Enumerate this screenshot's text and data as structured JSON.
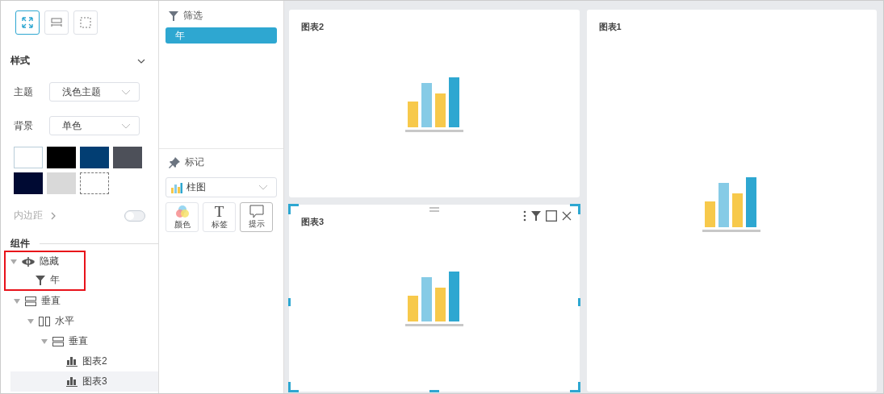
{
  "toolbar": [
    {
      "kind": "fit",
      "selected": true
    },
    {
      "kind": "width",
      "selected": false
    },
    {
      "kind": "free",
      "selected": false
    }
  ],
  "style": {
    "title": "样式",
    "expanded": true,
    "fields": [
      {
        "label": "主题",
        "value": "浅色主题"
      },
      {
        "label": "背景",
        "value": "单色"
      }
    ],
    "swatches": [
      {
        "kind": "color",
        "color": "#ffffff",
        "selected": true
      },
      {
        "kind": "color",
        "color": "#000000",
        "selected": false
      },
      {
        "kind": "color",
        "color": "#023e73",
        "selected": false
      },
      {
        "kind": "color",
        "color": "#4d5059",
        "selected": false
      },
      {
        "kind": "color",
        "color": "#000a33",
        "selected": false
      },
      {
        "kind": "color",
        "color": "#d9d9d9",
        "selected": false
      },
      {
        "kind": "none",
        "selected": false
      }
    ],
    "padding": {
      "label": "内边距",
      "on": false
    }
  },
  "components": {
    "title": "组件",
    "tree": [
      {
        "kind": "hidden",
        "label": "隐藏",
        "expanded": true,
        "highlighted": true,
        "selected": false,
        "children": [
          {
            "kind": "filter",
            "label": "年",
            "selected": false
          }
        ]
      },
      {
        "kind": "vertical",
        "label": "垂直",
        "expanded": true,
        "selected": false,
        "children": [
          {
            "kind": "horizontal",
            "label": "水平",
            "expanded": true,
            "selected": false,
            "children": [
              {
                "kind": "vertical",
                "label": "垂直",
                "expanded": true,
                "selected": false,
                "children": [
                  {
                    "kind": "chart",
                    "label": "图表2",
                    "selected": false
                  },
                  {
                    "kind": "chart",
                    "label": "图表3",
                    "selected": true
                  }
                ]
              }
            ]
          }
        ]
      }
    ]
  },
  "filter": {
    "title": "筛选",
    "items": [
      {
        "label": "年",
        "selected": true
      }
    ]
  },
  "marks": {
    "title": "标记",
    "chart_type": "柱图",
    "buttons": [
      {
        "kind": "color",
        "label": "颜色"
      },
      {
        "kind": "label",
        "glyph": "T",
        "label": "标签"
      },
      {
        "kind": "tooltip",
        "label": "提示"
      }
    ]
  },
  "widgets": [
    {
      "title": "图表2",
      "selected": false
    },
    {
      "title": "图表3",
      "selected": true
    },
    {
      "title": "图表1",
      "selected": false
    }
  ]
}
